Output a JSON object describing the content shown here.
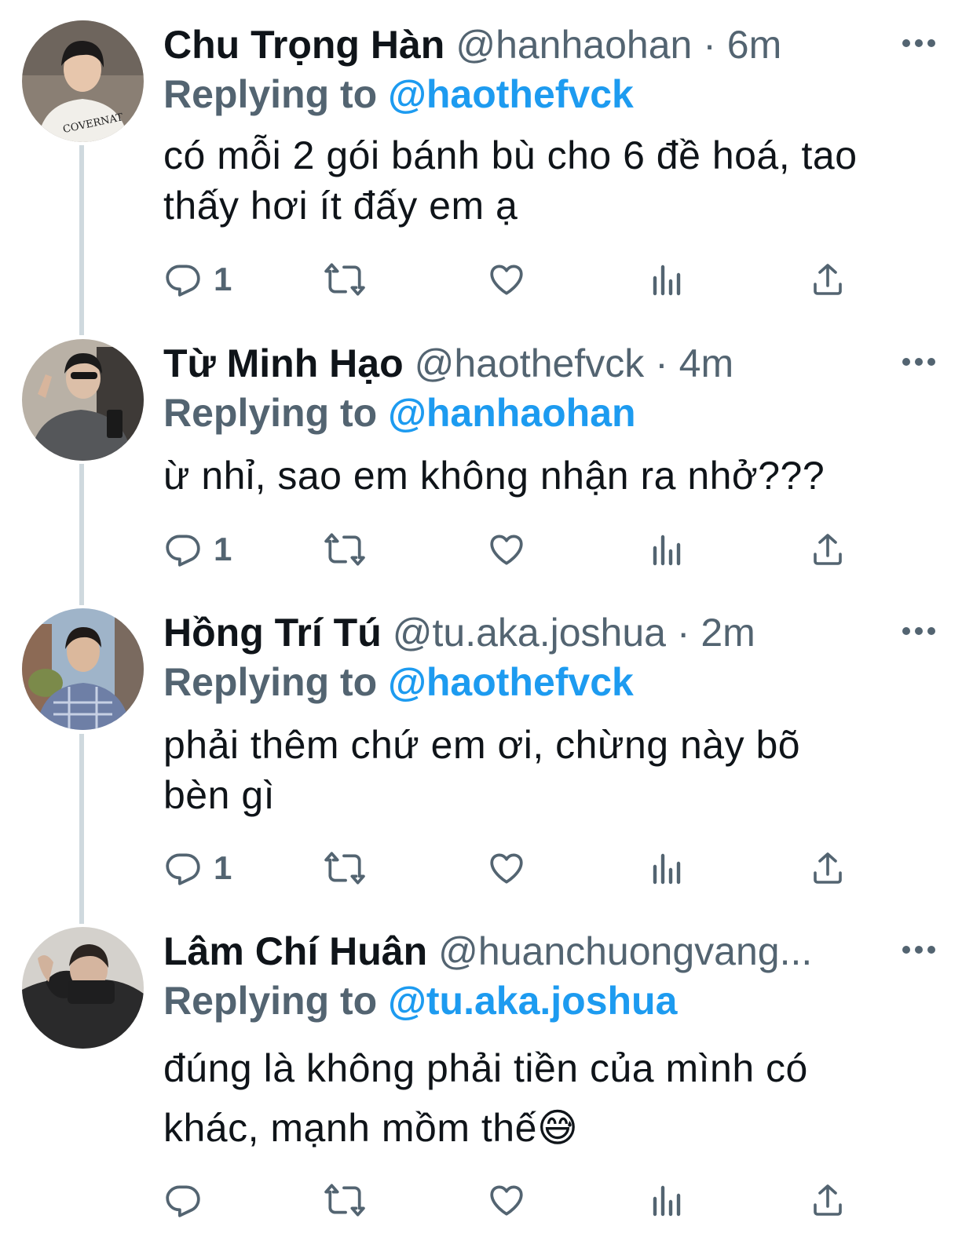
{
  "tweets": [
    {
      "name": "Chu Trọng Hàn",
      "meta": "@hanhaohan · 6m",
      "replying_prefix": "Replying to",
      "replying_handle": "@haothefvck",
      "text_lines": [
        "có mỗi 2 gói bánh bù cho 6 đề hoá, tao",
        "thấy hơi ít đấy em ạ"
      ],
      "reply_count": "1"
    },
    {
      "name": "Từ Minh Hạo",
      "meta": "@haothefvck · 4m",
      "replying_prefix": "Replying to",
      "replying_handle": "@hanhaohan",
      "text_lines": [
        "ừ nhỉ, sao em không nhận ra nhở???"
      ],
      "reply_count": "1"
    },
    {
      "name": "Hồng Trí Tú",
      "meta": "@tu.aka.joshua · 2m",
      "replying_prefix": "Replying to",
      "replying_handle": "@haothefvck",
      "text_lines": [
        "phải thêm chứ em ơi, chừng này bõ",
        "bèn gì"
      ],
      "reply_count": "1"
    },
    {
      "name": "Lâm Chí Huân",
      "meta": "@huanchuongvang...",
      "replying_prefix": "Replying to",
      "replying_handle": "@tu.aka.joshua",
      "text_lines": [
        "đúng là không phải tiền của mình có",
        "khác, mạnh mồm thế😅"
      ],
      "reply_count": ""
    }
  ],
  "icons": {
    "reply": "reply-icon",
    "retweet": "retweet-icon",
    "like": "heart-icon",
    "views": "views-icon",
    "share": "share-icon",
    "more": "more-icon"
  },
  "colors": {
    "text": "#0f1419",
    "secondary": "#536471",
    "accent": "#1d9bf0",
    "thread_line": "#cfd9de"
  }
}
